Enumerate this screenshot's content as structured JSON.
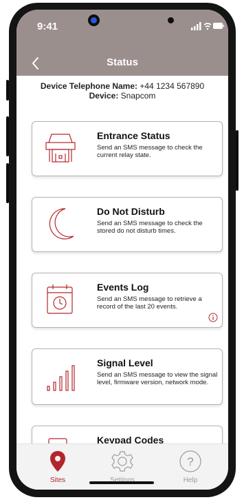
{
  "status_bar": {
    "time": "9:41"
  },
  "header": {
    "title": "Status"
  },
  "device": {
    "name_label": "Device Telephone Name:",
    "name_value": "+44 1234 567890",
    "type_label": "Device:",
    "type_value": "Snapcom"
  },
  "cards": [
    {
      "title": "Entrance Status",
      "description": "Send an SMS message to check the current relay state.",
      "icon": "relay-icon"
    },
    {
      "title": "Do Not Disturb",
      "description": "Send an SMS message to check the stored do not disturb times.",
      "icon": "moon-icon"
    },
    {
      "title": "Events Log",
      "description": "Send an SMS message to retrieve a record of the last 20 events.",
      "icon": "calendar-clock-icon"
    },
    {
      "title": "Signal Level",
      "description": "Send an SMS message to view the signal level, firmware version, network mode.",
      "icon": "signal-bars-icon"
    },
    {
      "title": "Keypad Codes",
      "description": "",
      "icon": "keypad-icon"
    }
  ],
  "tabs": [
    {
      "label": "Sites",
      "icon": "location-pin-icon",
      "active": true
    },
    {
      "label": "Settings",
      "icon": "gear-icon",
      "active": false
    },
    {
      "label": "Help",
      "icon": "help-circle-icon",
      "active": false
    }
  ],
  "colors": {
    "accent": "#b3262b",
    "header": "#9b8f8e",
    "inactive": "#9a9a9a"
  }
}
